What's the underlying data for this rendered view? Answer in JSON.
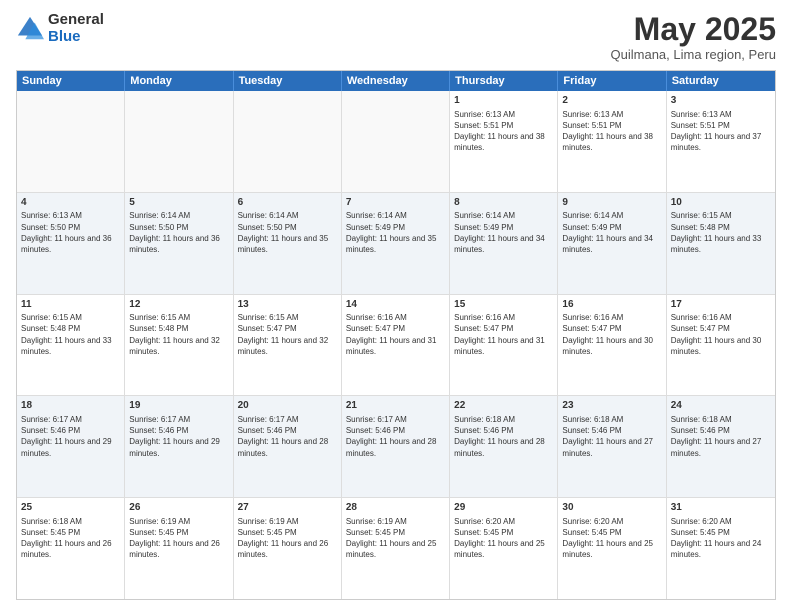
{
  "header": {
    "logo": {
      "general": "General",
      "blue": "Blue"
    },
    "title": "May 2025",
    "location": "Quilmana, Lima region, Peru"
  },
  "days_of_week": [
    "Sunday",
    "Monday",
    "Tuesday",
    "Wednesday",
    "Thursday",
    "Friday",
    "Saturday"
  ],
  "weeks": [
    [
      {
        "day": "",
        "empty": true
      },
      {
        "day": "",
        "empty": true
      },
      {
        "day": "",
        "empty": true
      },
      {
        "day": "",
        "empty": true
      },
      {
        "day": "1",
        "sunrise": "6:13 AM",
        "sunset": "5:51 PM",
        "daylight": "11 hours and 38 minutes."
      },
      {
        "day": "2",
        "sunrise": "6:13 AM",
        "sunset": "5:51 PM",
        "daylight": "11 hours and 38 minutes."
      },
      {
        "day": "3",
        "sunrise": "6:13 AM",
        "sunset": "5:51 PM",
        "daylight": "11 hours and 37 minutes."
      }
    ],
    [
      {
        "day": "4",
        "sunrise": "6:13 AM",
        "sunset": "5:50 PM",
        "daylight": "11 hours and 36 minutes."
      },
      {
        "day": "5",
        "sunrise": "6:14 AM",
        "sunset": "5:50 PM",
        "daylight": "11 hours and 36 minutes."
      },
      {
        "day": "6",
        "sunrise": "6:14 AM",
        "sunset": "5:50 PM",
        "daylight": "11 hours and 35 minutes."
      },
      {
        "day": "7",
        "sunrise": "6:14 AM",
        "sunset": "5:49 PM",
        "daylight": "11 hours and 35 minutes."
      },
      {
        "day": "8",
        "sunrise": "6:14 AM",
        "sunset": "5:49 PM",
        "daylight": "11 hours and 34 minutes."
      },
      {
        "day": "9",
        "sunrise": "6:14 AM",
        "sunset": "5:49 PM",
        "daylight": "11 hours and 34 minutes."
      },
      {
        "day": "10",
        "sunrise": "6:15 AM",
        "sunset": "5:48 PM",
        "daylight": "11 hours and 33 minutes."
      }
    ],
    [
      {
        "day": "11",
        "sunrise": "6:15 AM",
        "sunset": "5:48 PM",
        "daylight": "11 hours and 33 minutes."
      },
      {
        "day": "12",
        "sunrise": "6:15 AM",
        "sunset": "5:48 PM",
        "daylight": "11 hours and 32 minutes."
      },
      {
        "day": "13",
        "sunrise": "6:15 AM",
        "sunset": "5:47 PM",
        "daylight": "11 hours and 32 minutes."
      },
      {
        "day": "14",
        "sunrise": "6:16 AM",
        "sunset": "5:47 PM",
        "daylight": "11 hours and 31 minutes."
      },
      {
        "day": "15",
        "sunrise": "6:16 AM",
        "sunset": "5:47 PM",
        "daylight": "11 hours and 31 minutes."
      },
      {
        "day": "16",
        "sunrise": "6:16 AM",
        "sunset": "5:47 PM",
        "daylight": "11 hours and 30 minutes."
      },
      {
        "day": "17",
        "sunrise": "6:16 AM",
        "sunset": "5:47 PM",
        "daylight": "11 hours and 30 minutes."
      }
    ],
    [
      {
        "day": "18",
        "sunrise": "6:17 AM",
        "sunset": "5:46 PM",
        "daylight": "11 hours and 29 minutes."
      },
      {
        "day": "19",
        "sunrise": "6:17 AM",
        "sunset": "5:46 PM",
        "daylight": "11 hours and 29 minutes."
      },
      {
        "day": "20",
        "sunrise": "6:17 AM",
        "sunset": "5:46 PM",
        "daylight": "11 hours and 28 minutes."
      },
      {
        "day": "21",
        "sunrise": "6:17 AM",
        "sunset": "5:46 PM",
        "daylight": "11 hours and 28 minutes."
      },
      {
        "day": "22",
        "sunrise": "6:18 AM",
        "sunset": "5:46 PM",
        "daylight": "11 hours and 28 minutes."
      },
      {
        "day": "23",
        "sunrise": "6:18 AM",
        "sunset": "5:46 PM",
        "daylight": "11 hours and 27 minutes."
      },
      {
        "day": "24",
        "sunrise": "6:18 AM",
        "sunset": "5:46 PM",
        "daylight": "11 hours and 27 minutes."
      }
    ],
    [
      {
        "day": "25",
        "sunrise": "6:18 AM",
        "sunset": "5:45 PM",
        "daylight": "11 hours and 26 minutes."
      },
      {
        "day": "26",
        "sunrise": "6:19 AM",
        "sunset": "5:45 PM",
        "daylight": "11 hours and 26 minutes."
      },
      {
        "day": "27",
        "sunrise": "6:19 AM",
        "sunset": "5:45 PM",
        "daylight": "11 hours and 26 minutes."
      },
      {
        "day": "28",
        "sunrise": "6:19 AM",
        "sunset": "5:45 PM",
        "daylight": "11 hours and 25 minutes."
      },
      {
        "day": "29",
        "sunrise": "6:20 AM",
        "sunset": "5:45 PM",
        "daylight": "11 hours and 25 minutes."
      },
      {
        "day": "30",
        "sunrise": "6:20 AM",
        "sunset": "5:45 PM",
        "daylight": "11 hours and 25 minutes."
      },
      {
        "day": "31",
        "sunrise": "6:20 AM",
        "sunset": "5:45 PM",
        "daylight": "11 hours and 24 minutes."
      }
    ]
  ]
}
